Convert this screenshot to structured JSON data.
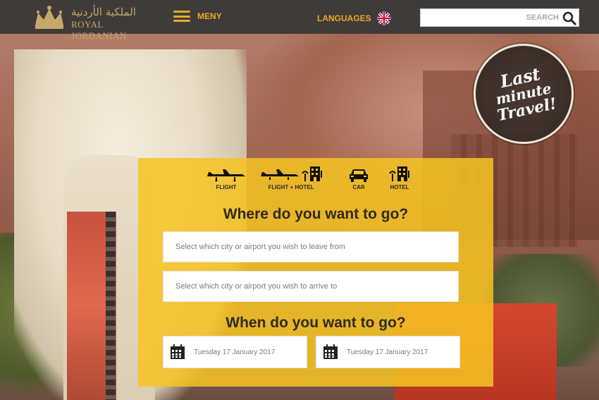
{
  "header": {
    "logo_arabic": "الملكية الأردنية",
    "logo_english": "ROYAL JORDANIAN",
    "menu_label": "MENY",
    "languages_label": "LANGUAGES",
    "search_placeholder": "SEARCH"
  },
  "badge": {
    "line1": "Last",
    "line2": "minute",
    "line3": "Travel!"
  },
  "booking": {
    "tabs": [
      {
        "label": "FLIGHT",
        "icons": [
          "plane-icon"
        ]
      },
      {
        "label": "FLIGHT + HOTEL",
        "icons": [
          "plane-icon",
          "hotel-icon"
        ]
      },
      {
        "label": "CAR",
        "icons": [
          "car-icon"
        ]
      },
      {
        "label": "HOTEL",
        "icons": [
          "hotel-icon"
        ]
      }
    ],
    "where_heading": "Where do you want to go?",
    "from_placeholder": "Select which city or airport you wish to leave from",
    "to_placeholder": "Select which city or airport you wish to arrive to",
    "when_heading": "When do you want to go?",
    "depart_date": "Tuesday 17 January 2017",
    "return_date": "Tuesday 17 January 2017"
  },
  "colors": {
    "accent": "#e8a92b",
    "panel": "#f6c423",
    "topbar": "#3f3b39"
  }
}
